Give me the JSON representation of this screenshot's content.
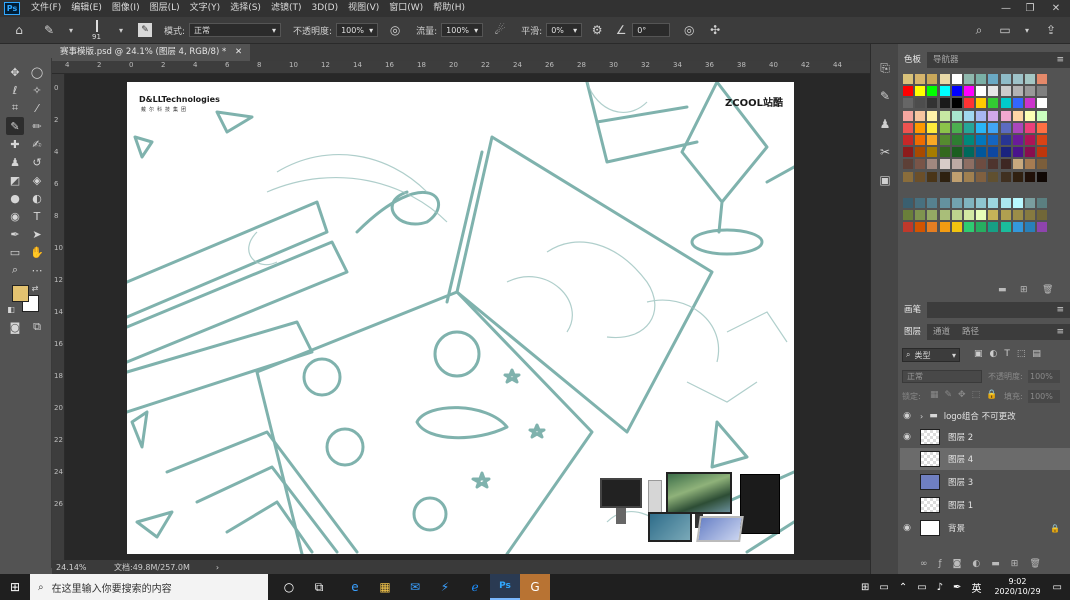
{
  "app": {
    "logo": "Ps"
  },
  "menu": [
    "文件(F)",
    "编辑(E)",
    "图像(I)",
    "图层(L)",
    "文字(Y)",
    "选择(S)",
    "滤镜(T)",
    "3D(D)",
    "视图(V)",
    "窗口(W)",
    "帮助(H)"
  ],
  "options": {
    "brush_size": "91",
    "mode_label": "模式:",
    "mode_value": "正常",
    "opacity_label": "不透明度:",
    "opacity_value": "100%",
    "flow_label": "流量:",
    "flow_value": "100%",
    "smooth_label": "平滑:",
    "smooth_value": "0%",
    "angle_value": "0°"
  },
  "document": {
    "tab_title": "赛事模版.psd @ 24.1% (图层 4, RGB/8) *"
  },
  "rulers": {
    "top": [
      "4",
      "2",
      "0",
      "2",
      "4",
      "6",
      "8",
      "10",
      "12",
      "14",
      "16",
      "18",
      "20",
      "22",
      "24",
      "26",
      "28",
      "30",
      "32",
      "34",
      "36",
      "38",
      "40",
      "42",
      "44"
    ],
    "left": [
      "0",
      "2",
      "4",
      "6",
      "8",
      "10",
      "12",
      "14",
      "16",
      "18",
      "20",
      "22",
      "24",
      "26"
    ]
  },
  "canvas": {
    "logo_left": "D&LLTechnologies",
    "logo_left_sub": "戴尔科技集团",
    "logo_right_a": "ZCOOL",
    "logo_right_b": "站酷"
  },
  "status": {
    "zoom": "24.14%",
    "doc_size": "文档:49.8M/257.0M"
  },
  "panels": {
    "color_tabs": [
      "色板",
      "导航器"
    ],
    "brush_tab": "画笔",
    "layer_tabs": [
      "图层",
      "通道",
      "路径"
    ],
    "filter_kind": "类型",
    "blend_mode": "正常",
    "opacity_label": "不透明度:",
    "opacity_value": "100%",
    "lock_label": "锁定:",
    "fill_label": "填充:",
    "fill_value": "100%",
    "layers": [
      {
        "name": "logo组合 不可更改",
        "visible": true,
        "type": "group"
      },
      {
        "name": "图层 2",
        "visible": true,
        "type": "pixel"
      },
      {
        "name": "图层 4",
        "visible": false,
        "type": "pixel",
        "selected": true
      },
      {
        "name": "图层 3",
        "visible": false,
        "type": "pixel"
      },
      {
        "name": "图层 1",
        "visible": false,
        "type": "pixel"
      },
      {
        "name": "背景",
        "visible": true,
        "type": "background"
      }
    ]
  },
  "taskbar": {
    "search_placeholder": "在这里输入你要搜索的内容",
    "ime": "英",
    "time": "9:02",
    "date": "2020/10/29"
  },
  "colors": {
    "foreground": "#e3c270",
    "background": "#ffffff",
    "sketch": "#7fb2ad"
  }
}
